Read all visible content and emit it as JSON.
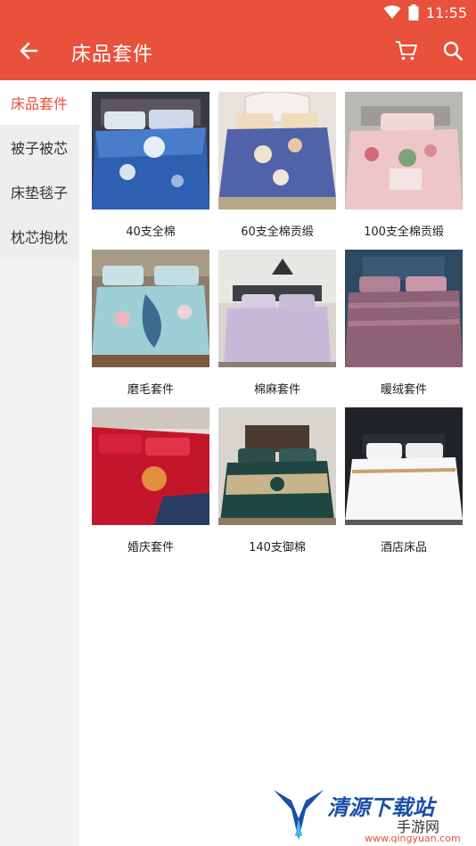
{
  "status_bar": {
    "time": "11:55"
  },
  "app_bar": {
    "title": "床品套件"
  },
  "sidebar": {
    "items": [
      {
        "label": "床品套件",
        "active": true
      },
      {
        "label": "被子被芯",
        "active": false
      },
      {
        "label": "床垫毯子",
        "active": false
      },
      {
        "label": "枕芯抱枕",
        "active": false
      }
    ]
  },
  "products": [
    {
      "label": "40支全棉"
    },
    {
      "label": "60支全棉贡缎"
    },
    {
      "label": "100支全棉贡缎"
    },
    {
      "label": "磨毛套件"
    },
    {
      "label": "棉麻套件"
    },
    {
      "label": "暖绒套件"
    },
    {
      "label": "婚庆套件"
    },
    {
      "label": "140支御棉"
    },
    {
      "label": "酒店床品"
    }
  ],
  "watermark": {
    "line1": "清源下载站",
    "line2": "手游网",
    "line3": "www.qingyuan.com"
  },
  "colors": {
    "accent": "#e8513b",
    "sidebar_bg": "#eeeeee"
  }
}
